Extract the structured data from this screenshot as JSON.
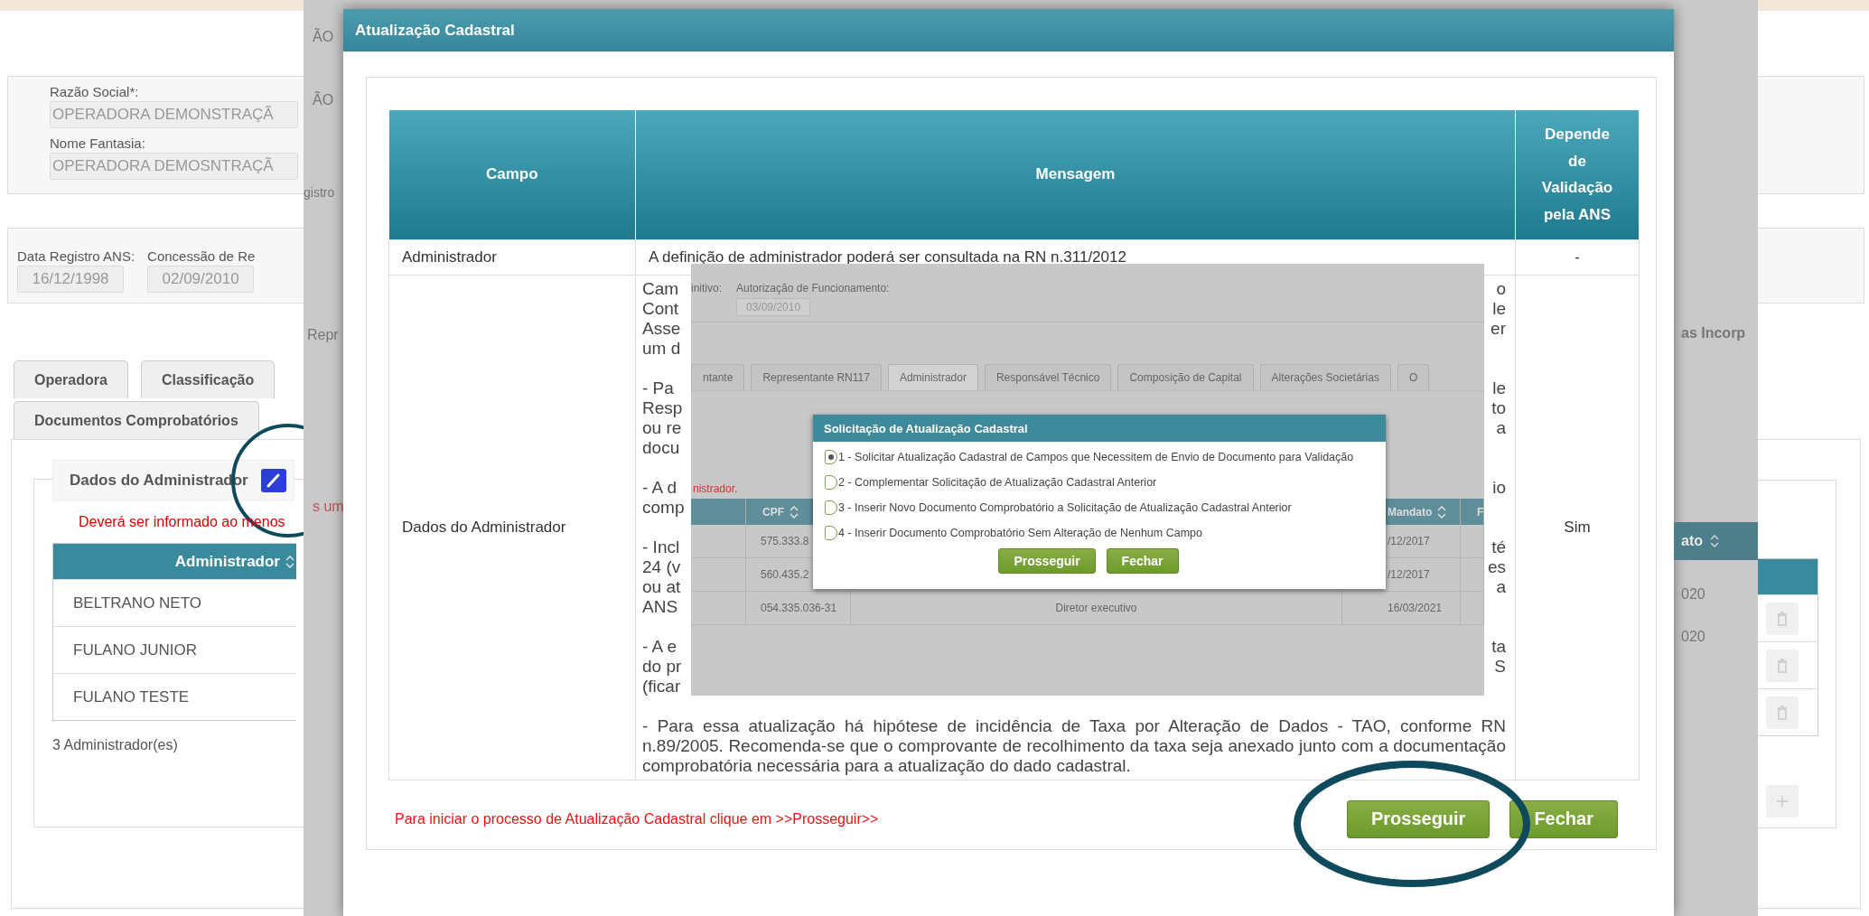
{
  "background_page": {
    "fields": [
      {
        "label": "Razão Social*:",
        "value": "OPERADORA DEMONSTRAÇÃ"
      },
      {
        "label": "Nome Fantasia:",
        "value": "OPERADORA DEMOSNTRAÇÃ"
      }
    ],
    "dates": [
      {
        "label": "Data Registro ANS:",
        "value": "16/12/1998"
      },
      {
        "label": "Concessão de Re",
        "value": "02/09/2010"
      }
    ],
    "tabs": [
      {
        "label": "Operadora",
        "selected": false
      },
      {
        "label": "Classificação",
        "selected": false
      },
      {
        "label": "Documentos Comprobatórios",
        "selected": false
      }
    ],
    "legend": "Dados do Administrador",
    "warning": "Deverá ser informado ao menos",
    "table": {
      "columns": [
        "Administrador"
      ],
      "rows": [
        "BELTRANO NETO",
        "FULANO JUNIOR",
        "FULANO TESTE"
      ]
    },
    "count": "3 Administrador(es)",
    "fragments_left": [
      {
        "text": "ÃO",
        "kind": "plain"
      },
      {
        "text": "ÃO",
        "kind": "plain"
      },
      {
        "text": "gistro",
        "kind": "plain"
      },
      {
        "text": "Repr",
        "kind": "plain"
      },
      {
        "text": "s um",
        "kind": "warning"
      }
    ],
    "fragments_right": {
      "tab": "as Incorp",
      "column": "ato",
      "cells": [
        "020",
        "020"
      ]
    }
  },
  "modal": {
    "title": "Atualização Cadastral",
    "columns": [
      "Campo",
      "Mensagem",
      "Depende de Validação pela ANS"
    ],
    "rows": [
      {
        "campo": "Administrador",
        "mensagem": "A definição de administrador poderá ser consultada na RN n.311/2012",
        "depende": "-"
      },
      {
        "campo": "Dados do Administrador",
        "fragment_paragraphs": [
          [
            {
              "left": "Cam",
              "right": "o"
            },
            {
              "left": "Cont",
              "right": "le"
            },
            {
              "left": "Asse",
              "right": "er"
            },
            {
              "left": "um d"
            }
          ],
          [
            {
              "left": "- Pa",
              "right": "le"
            },
            {
              "left": "Resp",
              "right": "to"
            },
            {
              "left": "ou re",
              "right": "a"
            },
            {
              "left": "docu"
            }
          ],
          [
            {
              "left": "- A d",
              "right": "io"
            },
            {
              "left": "comp"
            }
          ],
          [
            {
              "left": "- Incl",
              "right": "té"
            },
            {
              "left": "24 (v",
              "right": "es"
            },
            {
              "left": "ou at",
              "right": "a"
            },
            {
              "left": "ANS"
            }
          ],
          [
            {
              "left": "- A e",
              "right": "ta"
            },
            {
              "left": "do pr",
              "right": "S"
            },
            {
              "left": "(ficar"
            }
          ]
        ],
        "mensagem": "- Para essa atualização há hipótese de incidência de Taxa por Alteração de Dados - TAO, conforme RN n.89/2005. Recomenda-se que o comprovante de recolhimento da taxa seja anexado junto com a documentação comprobatória necessária para a atualização do dado cadastral.",
        "depende": "Sim"
      }
    ],
    "footer_note": "Para iniciar o processo de Atualização Cadastral clique em >>Prosseguir>>",
    "buttons": [
      "Prosseguir",
      "Fechar"
    ]
  },
  "inset": {
    "label_fragment": "initivo:",
    "field_label": "Autorização de Funcionamento:",
    "field_value": "03/09/2010",
    "tabs": [
      {
        "label": "ntante",
        "selected": false
      },
      {
        "label": "Representante RN117",
        "selected": false
      },
      {
        "label": "Administrador",
        "selected": true
      },
      {
        "label": "Responsável Técnico",
        "selected": false
      },
      {
        "label": "Composição de Capital",
        "selected": false
      },
      {
        "label": "Alterações Societárias",
        "selected": false
      },
      {
        "label": "O",
        "selected": false
      }
    ],
    "warning": "nistrador.",
    "table": {
      "columns": [
        {
          "label": "CPF",
          "sortable": true
        },
        {
          "label": "Mandato",
          "sortable": true
        },
        {
          "label": "F"
        }
      ],
      "rows": [
        {
          "cpf": "575.333.8",
          "mandato": "/12/2017"
        },
        {
          "cpf": "560.435.2",
          "mandato": "/12/2017"
        },
        {
          "cpf": "054.335.036-31",
          "column_3": "Diretor executivo",
          "mandato": "16/03/2021"
        }
      ]
    },
    "dialog": {
      "title": "Solicitação de Atualização Cadastral",
      "options": [
        {
          "label": "1 - Solicitar Atualização Cadastral de Campos que Necessitem de Envio de Documento para Validação",
          "selected": true
        },
        {
          "label": "2 - Complementar Solicitação de Atualização Cadastral Anterior",
          "selected": false
        },
        {
          "label": "3 - Inserir Novo Documento Comprobatório a Solicitação de Atualização Cadastral Anterior",
          "selected": false
        },
        {
          "label": "4 - Inserir Documento Comprobatório Sem Alteração de Nenhum Campo",
          "selected": false
        }
      ],
      "buttons": [
        "Prosseguir",
        "Fechar"
      ]
    }
  }
}
